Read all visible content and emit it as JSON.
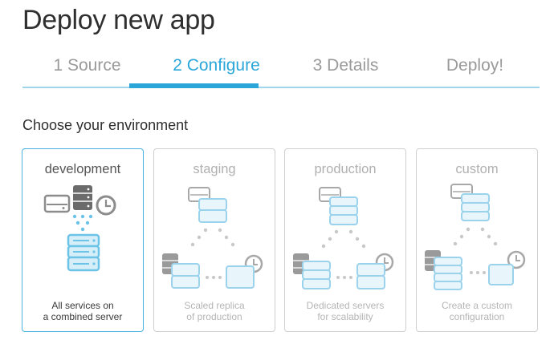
{
  "header": {
    "title": "Deploy new app"
  },
  "tabs": [
    {
      "label": "1 Source"
    },
    {
      "label": "2 Configure"
    },
    {
      "label": "3 Details"
    },
    {
      "label": "Deploy!"
    }
  ],
  "active_tab": "2 Configure",
  "section_title": "Choose your environment",
  "environments": [
    {
      "name": "development",
      "line1": "All services on",
      "line2": "a combined server",
      "selected": true
    },
    {
      "name": "staging",
      "line1": "Scaled replica",
      "line2": "of production",
      "selected": false
    },
    {
      "name": "production",
      "line1": "Dedicated servers",
      "line2": "for scalability",
      "selected": false
    },
    {
      "name": "custom",
      "line1": "Create a custom",
      "line2": "configuration",
      "selected": false
    }
  ],
  "colors": {
    "accent": "#2aa7d8",
    "accent_light": "#9fd6ec",
    "server_fill": "#d6eef8",
    "server_stroke": "#6cc3e8",
    "muted": "#b0b0b0"
  }
}
